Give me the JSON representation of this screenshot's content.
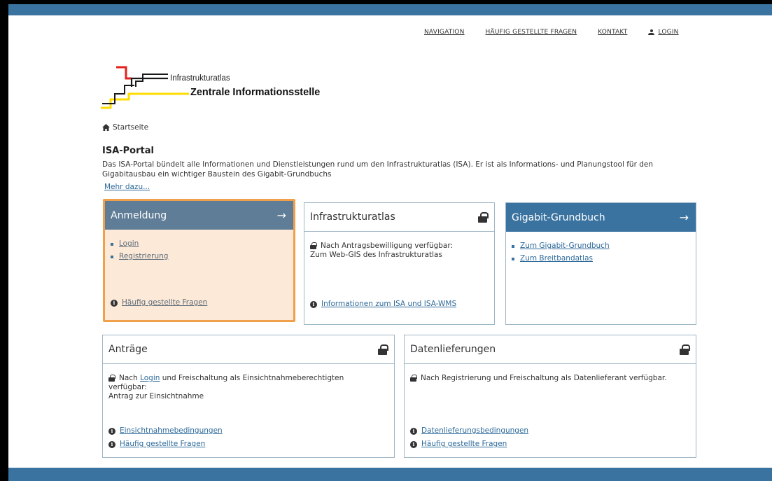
{
  "nav": {
    "navigation": "NAVIGATION",
    "faq": "HÄUFIG GESTELLTE FRAGEN",
    "contact": "KONTAKT",
    "login": "LOGIN"
  },
  "logo": {
    "top": "Infrastrukturatlas",
    "main": "Zentrale Informationsstelle",
    "colors": {
      "red": "#e3221e",
      "yellow": "#ffdc00",
      "black": "#1a1a1a"
    }
  },
  "breadcrumb": {
    "home": "Startseite"
  },
  "intro": {
    "title": "ISA-Portal",
    "text": "Das ISA-Portal bündelt alle Informationen und Dienstleistungen rund um den Infrastrukturatlas (ISA). Er ist als Informations- und Planungstool für den Gigabitausbau ein wichtiger Baustein des Gigabit-Grundbuchs",
    "more": "Mehr dazu..."
  },
  "cards": {
    "anmeldung": {
      "title": "Anmeldung",
      "items": [
        "Login",
        "Registrierung"
      ],
      "faq": "Häufig gestellte Fragen"
    },
    "isa": {
      "title": "Infrastrukturatlas",
      "text_line1": "Nach Antragsbewilligung verfügbar:",
      "text_line2": "Zum Web-GIS des Infrastrukturatlas",
      "info_link": "Informationen zum ISA und ISA-WMS"
    },
    "gigabit": {
      "title": "Gigabit-Grundbuch",
      "items": [
        "Zum Gigabit-Grundbuch",
        "Zum Breitbandatlas"
      ]
    },
    "antraege": {
      "title": "Anträge",
      "text_pre": "Nach ",
      "text_link": "Login",
      "text_post": " und Freischaltung als Einsichtnahmeberechtigten",
      "text_line2": "verfügbar:",
      "text_line3": "Antrag zur Einsichtnahme",
      "link1": "Einsichtnahmebedingungen",
      "link2": "Häufig gestellte Fragen"
    },
    "daten": {
      "title": "Datenlieferungen",
      "text": "Nach Registrierung und Freischaltung als Datenlieferant verfügbar.",
      "link1": "Datenlieferungsbedingungen",
      "link2": "Häufig gestellte Fragen"
    }
  },
  "colors": {
    "brand_blue": "#3a73a0",
    "header_gray": "#5f7d96",
    "highlight_border": "#f0a04b",
    "highlight_fill": "#fde9d8"
  }
}
